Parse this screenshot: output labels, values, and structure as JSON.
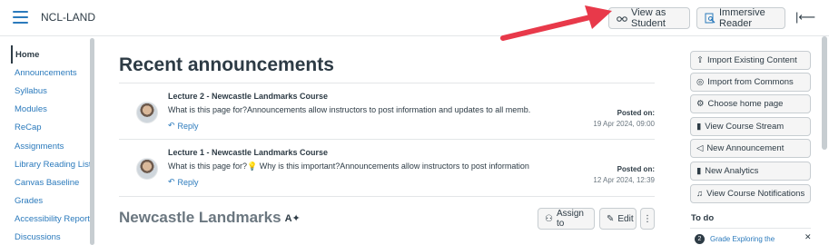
{
  "header": {
    "course_title": "NCL-LAND",
    "view_as_student": "View as Student",
    "immersive_reader": "Immersive Reader"
  },
  "nav": {
    "items": [
      "Home",
      "Announcements",
      "Syllabus",
      "Modules",
      "ReCap",
      "Assignments",
      "Library Reading List",
      "Canvas Baseline",
      "Grades",
      "Accessibility Report",
      "Discussions"
    ]
  },
  "main": {
    "title": "Recent announcements",
    "announcements": [
      {
        "title": "Lecture 2 - Newcastle Landmarks Course",
        "body": "What is this page for?Announcements allow instructors to post information and updates to all memb...",
        "reply": "Reply",
        "posted_label": "Posted on:",
        "posted_date": "19 Apr 2024, 09:00"
      },
      {
        "title": "Lecture 1 - Newcastle Landmarks Course",
        "body_before": "What is this page for?",
        "body_after": " Why is this important?Announcements allow instructors to post information ...",
        "reply": "Reply",
        "posted_label": "Posted on:",
        "posted_date": "12 Apr 2024, 12:39"
      }
    ],
    "section_title": "Newcastle Landmarks",
    "assign_to": "Assign to",
    "edit": "Edit"
  },
  "sidebar": {
    "buttons": [
      "Import Existing Content",
      "Import from Commons",
      "Choose home page",
      "View Course Stream",
      "New Announcement",
      "New Analytics",
      "View Course Notifications"
    ],
    "todo_heading": "To do",
    "todo_item_number": "2",
    "todo_item_text": "Grade Exploring the"
  },
  "colors": {
    "link": "#2b7abc",
    "text": "#2d3b45",
    "arrow": "#e8394a"
  }
}
